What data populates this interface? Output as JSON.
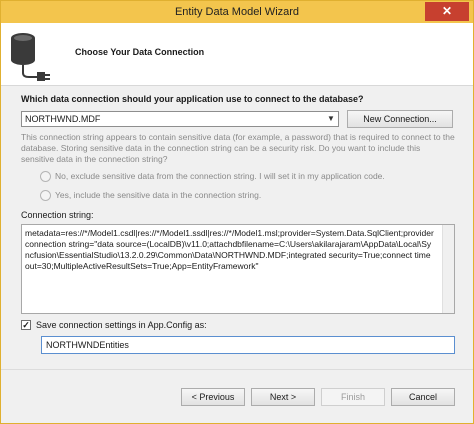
{
  "window": {
    "title": "Entity Data Model Wizard",
    "close_glyph": "✕"
  },
  "header": {
    "title": "Choose Your Data Connection",
    "icon": "database-plug-icon"
  },
  "question": "Which data connection should your application use to connect to the database?",
  "connection": {
    "selected": "NORTHWND.MDF",
    "new_connection_label": "New Connection..."
  },
  "sensitive_notice": "This connection string appears to contain sensitive data (for example, a password) that is required to connect to the database. Storing sensitive data in the connection string can be a security risk. Do you want to include this sensitive data in the connection string?",
  "options": {
    "exclude": "No, exclude sensitive data from the connection string. I will set it in my application code.",
    "include": "Yes, include the sensitive data in the connection string."
  },
  "connection_string": {
    "label": "Connection string:",
    "value": "metadata=res://*/Model1.csdl|res://*/Model1.ssdl|res://*/Model1.msl;provider=System.Data.SqlClient;provider connection string=\"data source=(LocalDB)\\v11.0;attachdbfilename=C:\\Users\\akilarajaram\\AppData\\Local\\Syncfusion\\EssentialStudio\\13.2.0.29\\Common\\Data\\NORTHWND.MDF;integrated security=True;connect timeout=30;MultipleActiveResultSets=True;App=EntityFramework\""
  },
  "save_settings": {
    "label": "Save connection settings in App.Config as:",
    "checked": true,
    "checkmark": "✓",
    "value": "NORTHWNDEntities"
  },
  "buttons": {
    "previous": "< Previous",
    "next": "Next >",
    "finish": "Finish",
    "cancel": "Cancel"
  },
  "colors": {
    "titlebar": "#f3c54d",
    "close": "#c7402f"
  }
}
